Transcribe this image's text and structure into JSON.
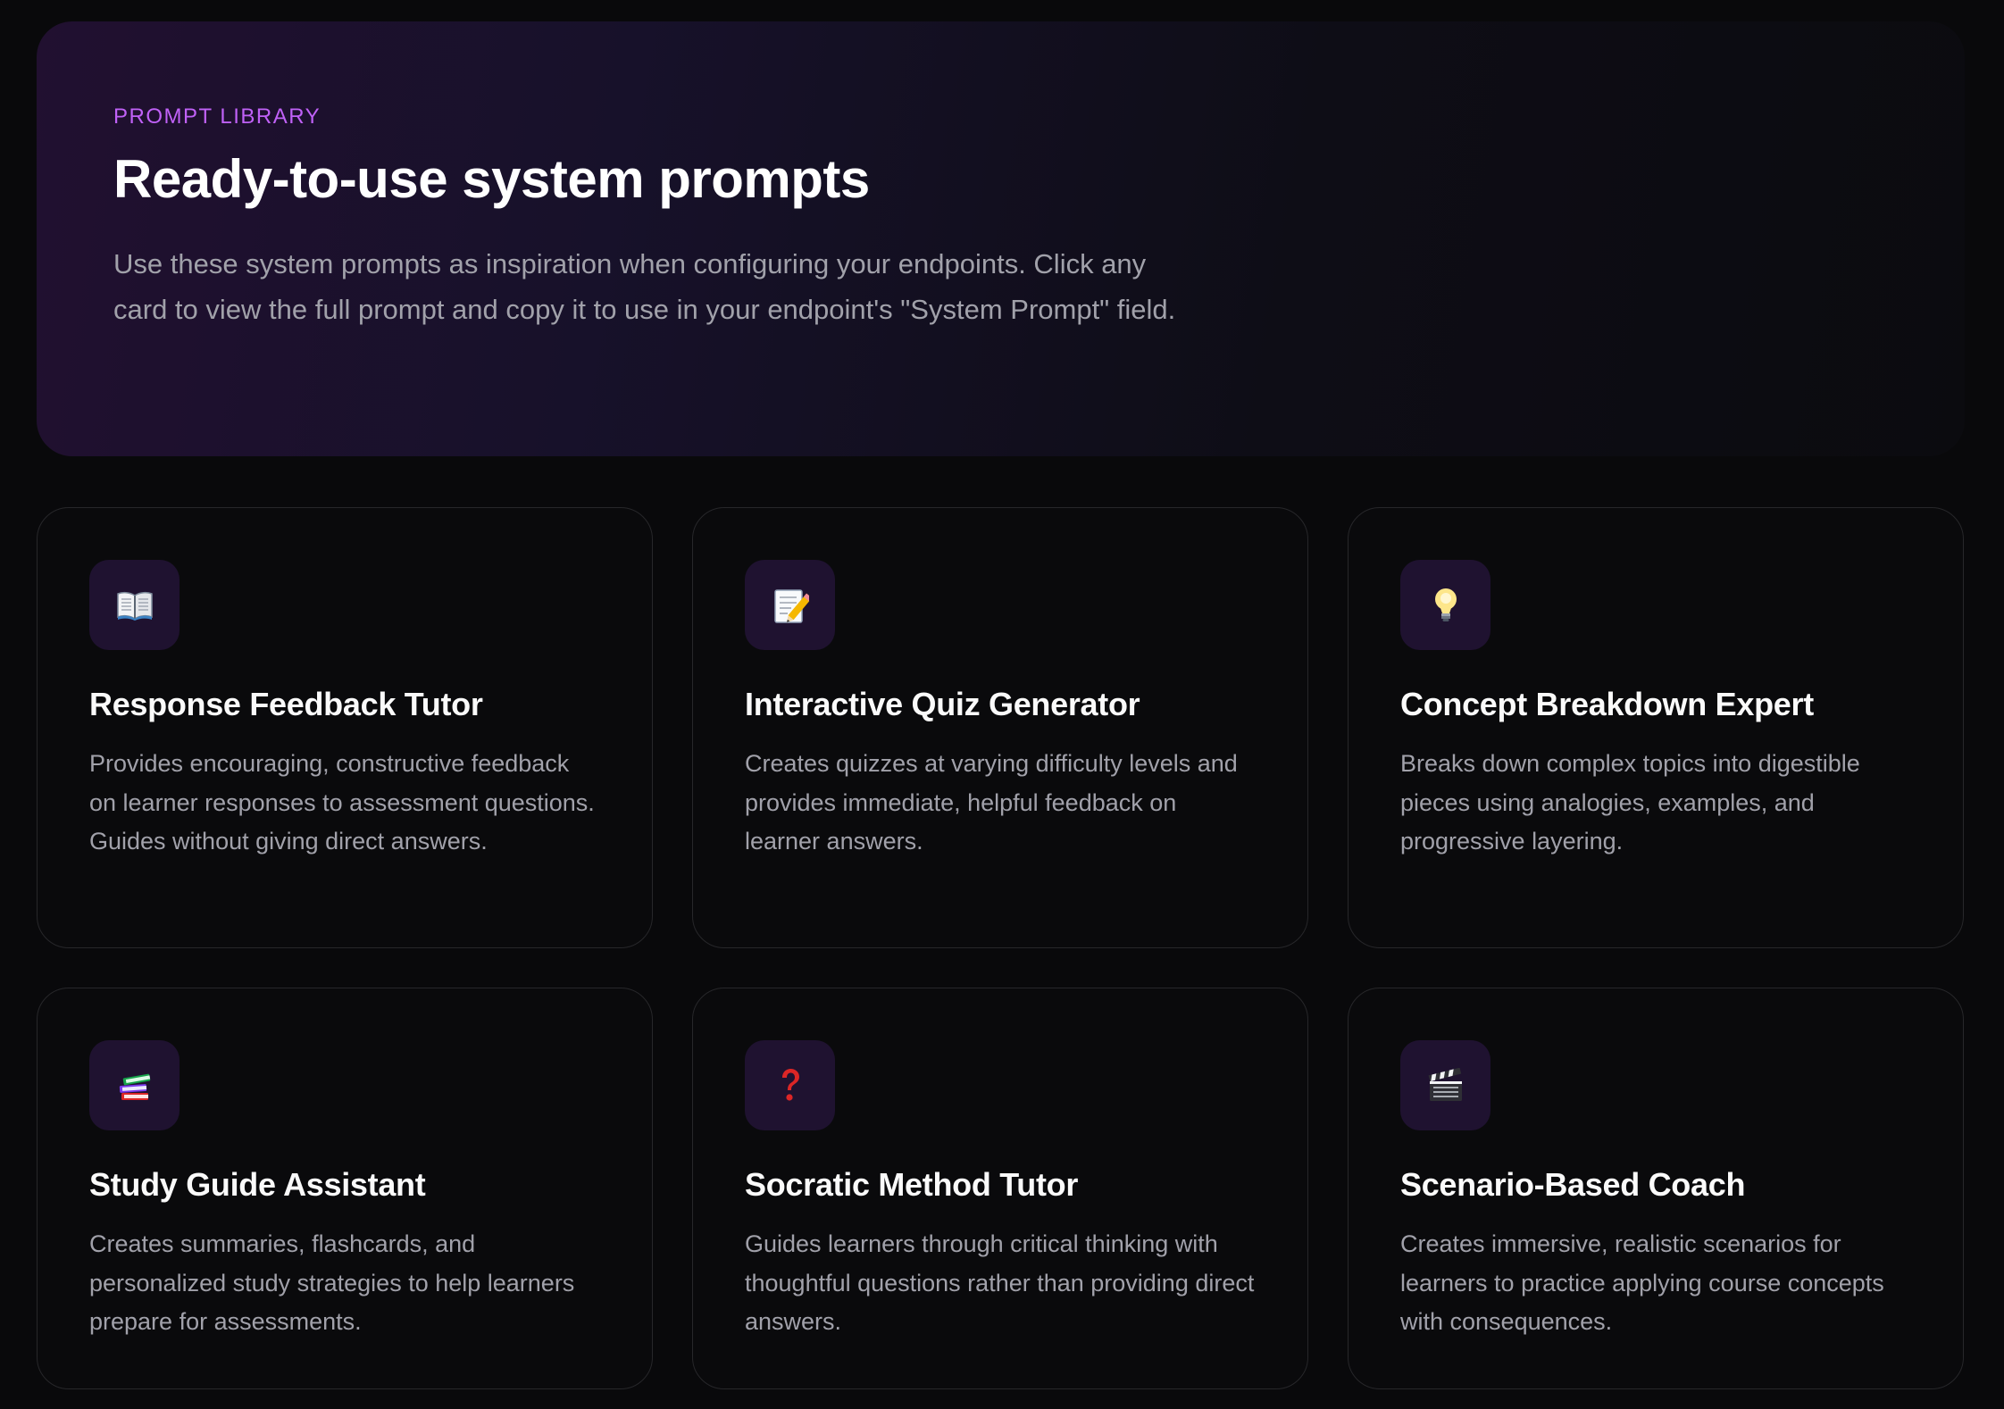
{
  "header": {
    "eyebrow": "PROMPT LIBRARY",
    "title": "Ready-to-use system prompts",
    "description": "Use these system prompts as inspiration when configuring your endpoints. Click any card to view the full prompt and copy it to use in your endpoint's \"System Prompt\" field."
  },
  "colors": {
    "accent": "#c061f7",
    "background": "#09090b",
    "card_border": "#27272a",
    "icon_tile": "#1f1230"
  },
  "cards": [
    {
      "icon": "open-book-icon",
      "title": "Response Feedback Tutor",
      "description": "Provides encouraging, constructive feedback on learner responses to assessment questions. Guides without giving direct answers."
    },
    {
      "icon": "memo-icon",
      "title": "Interactive Quiz Generator",
      "description": "Creates quizzes at varying difficulty levels and provides immediate, helpful feedback on learner answers."
    },
    {
      "icon": "light-bulb-icon",
      "title": "Concept Breakdown Expert",
      "description": "Breaks down complex topics into digestible pieces using analogies, examples, and progressive layering."
    },
    {
      "icon": "books-icon",
      "title": "Study Guide Assistant",
      "description": "Creates summaries, flashcards, and personalized study strategies to help learners prepare for assessments."
    },
    {
      "icon": "question-mark-icon",
      "title": "Socratic Method Tutor",
      "description": "Guides learners through critical thinking with thoughtful questions rather than providing direct answers."
    },
    {
      "icon": "clapper-board-icon",
      "title": "Scenario-Based Coach",
      "description": "Creates immersive, realistic scenarios for learners to practice applying course concepts with consequences."
    }
  ]
}
